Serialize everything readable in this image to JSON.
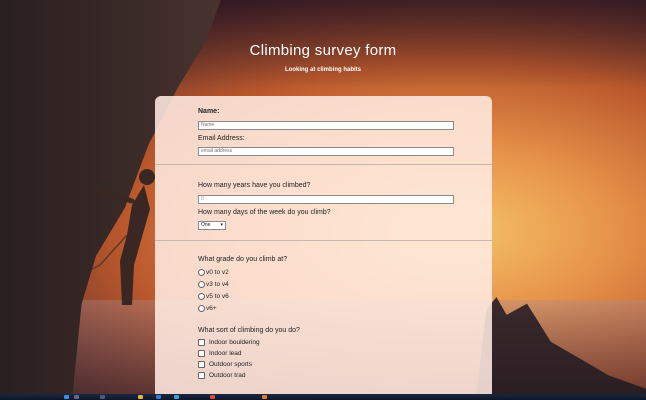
{
  "header": {
    "title": "Climbing survey form",
    "subtitle": "Looking at climbing habits"
  },
  "form": {
    "name_label": "Name:",
    "name_placeholder": "Name",
    "email_label": "Email Address:",
    "email_placeholder": "email address",
    "years_label": "How many years have you climbed?",
    "years_value": "0",
    "days_label": "How many days of the week do you climb?",
    "days_selected": "One",
    "grade_label": "What grade do you climb at?",
    "grade_options": [
      "v0 to v2",
      "v3 to v4",
      "v5 to v6",
      "v6+"
    ],
    "type_label": "What sort of climbing do you do?",
    "type_options": [
      "Indoor bouldering",
      "Indoor lead",
      "Outdoor sports",
      "Outdoor trad"
    ]
  },
  "colors": {
    "card_bg": "#ffebe1",
    "taskbar": "#0e1628"
  },
  "taskbar_icons": [
    "windows-icon",
    "search-icon",
    "taskview-icon",
    "folder-icon",
    "store-icon",
    "browser-icon",
    "mail-icon",
    "app-icon"
  ]
}
